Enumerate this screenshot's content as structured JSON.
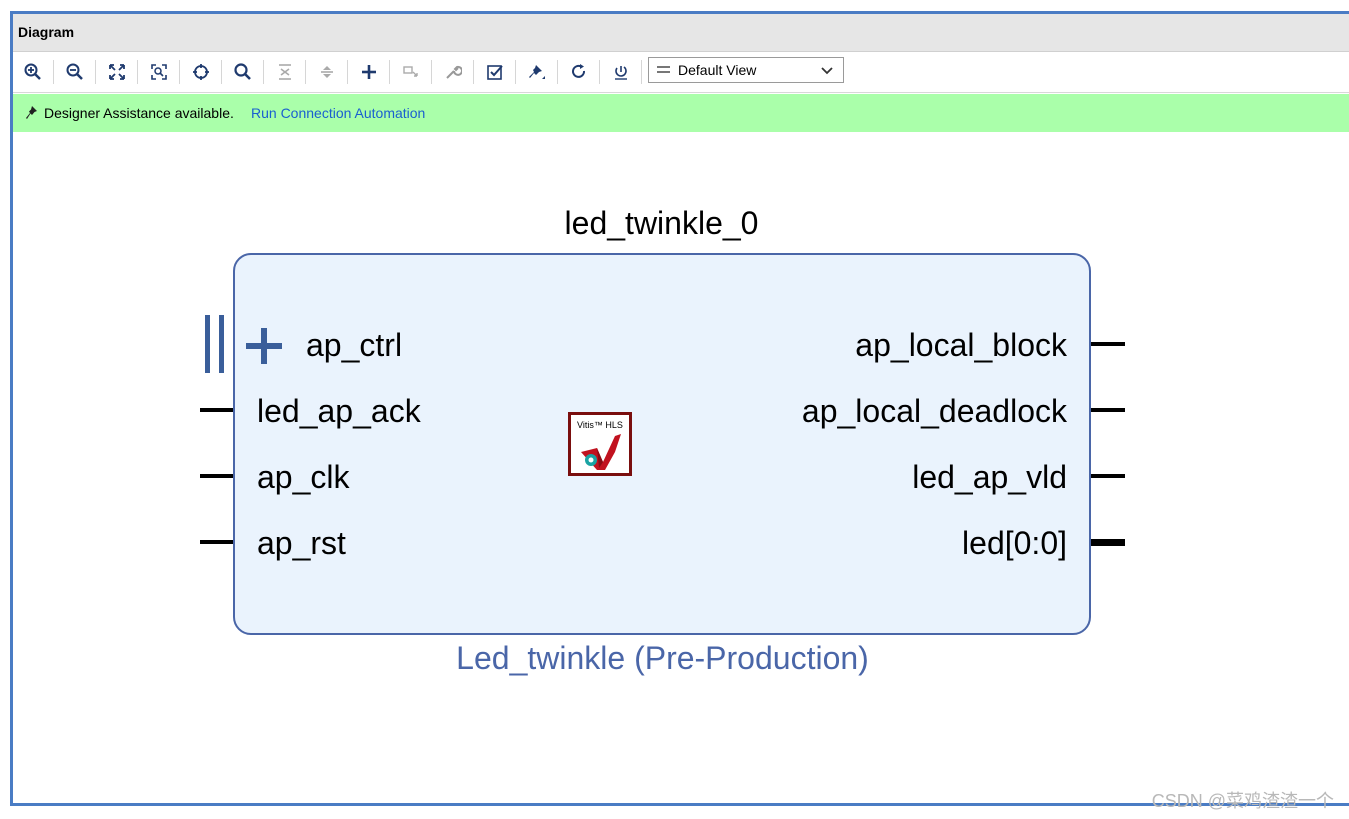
{
  "panel": {
    "title": "Diagram"
  },
  "toolbar": {
    "buttons": [
      {
        "icon": "zoom-in-icon"
      },
      {
        "icon": "zoom-out-icon"
      },
      {
        "icon": "zoom-fit-icon"
      },
      {
        "icon": "zoom-area-icon"
      },
      {
        "icon": "center-icon"
      },
      {
        "icon": "search-icon"
      },
      {
        "icon": "collapse-icon"
      },
      {
        "icon": "expand-icon"
      },
      {
        "icon": "add-ip-icon"
      },
      {
        "icon": "add-module-icon"
      },
      {
        "icon": "wrench-icon"
      },
      {
        "icon": "validate-icon"
      },
      {
        "icon": "pin-icon"
      },
      {
        "icon": "refresh-icon"
      },
      {
        "icon": "regenerate-layout-icon"
      }
    ],
    "view_select": {
      "value": "Default View"
    }
  },
  "assistance": {
    "message": "Designer Assistance available.",
    "link": "Run Connection Automation",
    "bg_color": "#aaffaa"
  },
  "block": {
    "name": "led_twinkle_0",
    "subtitle": "Led_twinkle (Pre-Production)",
    "logo_text": "Vitis™ HLS",
    "left_ports": [
      "ap_ctrl",
      "led_ap_ack",
      "ap_clk",
      "ap_rst"
    ],
    "right_ports": [
      "ap_local_block",
      "ap_local_deadlock",
      "led_ap_vld",
      "led[0:0]"
    ]
  },
  "watermark": "CSDN @菜鸡渣渣一个"
}
